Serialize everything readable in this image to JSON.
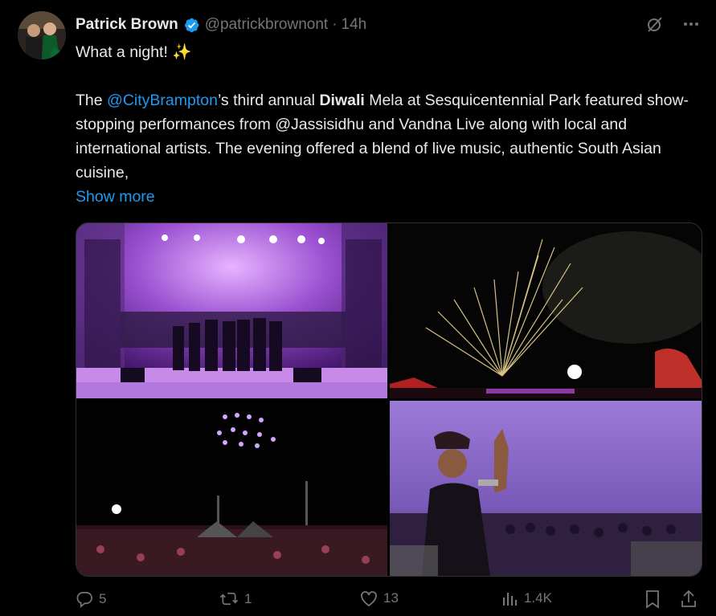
{
  "tweet": {
    "author_name": "Patrick Brown",
    "author_handle": "@patrickbrownont",
    "separator": "·",
    "time": "14h",
    "line1": "What a night! ✨",
    "body_prefix": "The ",
    "mention1": "@CityBrampton",
    "body_mid1": "’s third annual ",
    "bold_word": "Diwali",
    "body_rest": " Mela at Sesquicentennial Park featured show-stopping performances from @Jassisidhu and Vandna Live along with local and international artists. The evening offered a blend of live music, authentic South Asian cuisine,",
    "show_more": "Show more"
  },
  "stats": {
    "replies": "5",
    "reposts": "1",
    "likes": "13",
    "views": "1.4K"
  },
  "icons": [
    "verified-badge-icon",
    "grok-icon",
    "more-icon",
    "reply-icon",
    "repost-icon",
    "like-icon",
    "views-icon",
    "bookmark-icon",
    "share-icon"
  ],
  "colors": {
    "background": "#000000",
    "text": "#e7e9ea",
    "muted": "#71767b",
    "accent": "#1d9bf0"
  }
}
